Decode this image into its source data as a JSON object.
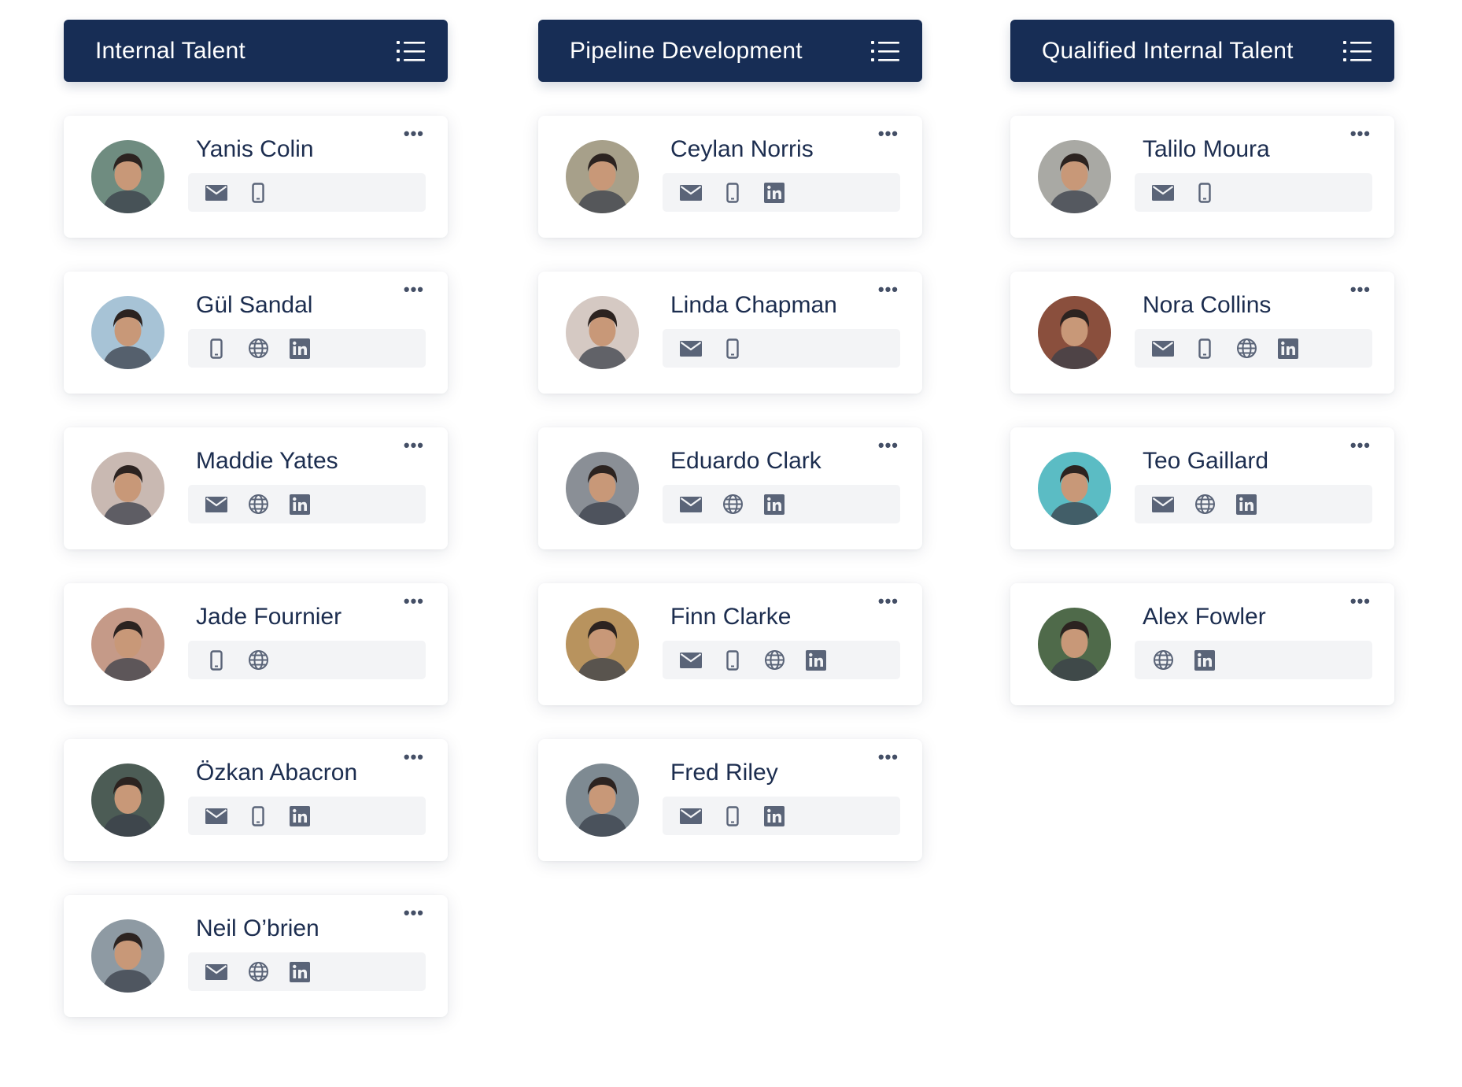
{
  "colors": {
    "header_bg": "#172d55",
    "header_text": "#ffffff",
    "name_text": "#1c2d4f",
    "icon": "#5a6478",
    "contact_bar_bg": "#f3f4f6",
    "card_bg": "#ffffff"
  },
  "columns": [
    {
      "title": "Internal Talent",
      "menu_icon": "list-icon",
      "cards": [
        {
          "name": "Yanis Colin",
          "more_label": "•••",
          "contacts": [
            "email",
            "phone"
          ],
          "avatar_color": "#6f8c80"
        },
        {
          "name": "Gül Sandal",
          "more_label": "•••",
          "contacts": [
            "phone",
            "web",
            "linkedin"
          ],
          "avatar_color": "#a7c3d6"
        },
        {
          "name": "Maddie Yates",
          "more_label": "•••",
          "contacts": [
            "email",
            "web",
            "linkedin"
          ],
          "avatar_color": "#c9b9b2"
        },
        {
          "name": "Jade Fournier",
          "more_label": "•••",
          "contacts": [
            "phone",
            "web"
          ],
          "avatar_color": "#c59a88"
        },
        {
          "name": "Özkan Abacron",
          "more_label": "•••",
          "contacts": [
            "email",
            "phone",
            "linkedin"
          ],
          "avatar_color": "#4c5c55"
        },
        {
          "name": "Neil O’brien",
          "more_label": "•••",
          "contacts": [
            "email",
            "web",
            "linkedin"
          ],
          "avatar_color": "#8e9aa3"
        }
      ]
    },
    {
      "title": "Pipeline Development",
      "menu_icon": "list-icon",
      "cards": [
        {
          "name": "Ceylan Norris",
          "more_label": "•••",
          "contacts": [
            "email",
            "phone",
            "linkedin"
          ],
          "avatar_color": "#a7a08a"
        },
        {
          "name": "Linda Chapman",
          "more_label": "•••",
          "contacts": [
            "email",
            "phone"
          ],
          "avatar_color": "#d5c9c3"
        },
        {
          "name": "Eduardo Clark",
          "more_label": "•••",
          "contacts": [
            "email",
            "web",
            "linkedin"
          ],
          "avatar_color": "#8a8f96"
        },
        {
          "name": "Finn Clarke",
          "more_label": "•••",
          "contacts": [
            "email",
            "phone",
            "web",
            "linkedin"
          ],
          "avatar_color": "#b8935e"
        },
        {
          "name": "Fred Riley",
          "more_label": "•••",
          "contacts": [
            "email",
            "phone",
            "linkedin"
          ],
          "avatar_color": "#7e8a92"
        }
      ]
    },
    {
      "title": "Qualified Internal Talent",
      "menu_icon": "list-icon",
      "cards": [
        {
          "name": "Talilo Moura",
          "more_label": "•••",
          "contacts": [
            "email",
            "phone"
          ],
          "avatar_color": "#a9a9a4"
        },
        {
          "name": "Nora Collins",
          "more_label": "•••",
          "contacts": [
            "email",
            "phone",
            "web",
            "linkedin"
          ],
          "avatar_color": "#8a4f3d"
        },
        {
          "name": "Teo Gaillard",
          "more_label": "•••",
          "contacts": [
            "email",
            "web",
            "linkedin"
          ],
          "avatar_color": "#5bbcc4"
        },
        {
          "name": "Alex Fowler",
          "more_label": "•••",
          "contacts": [
            "web",
            "linkedin"
          ],
          "avatar_color": "#4f6a4a"
        }
      ]
    }
  ]
}
